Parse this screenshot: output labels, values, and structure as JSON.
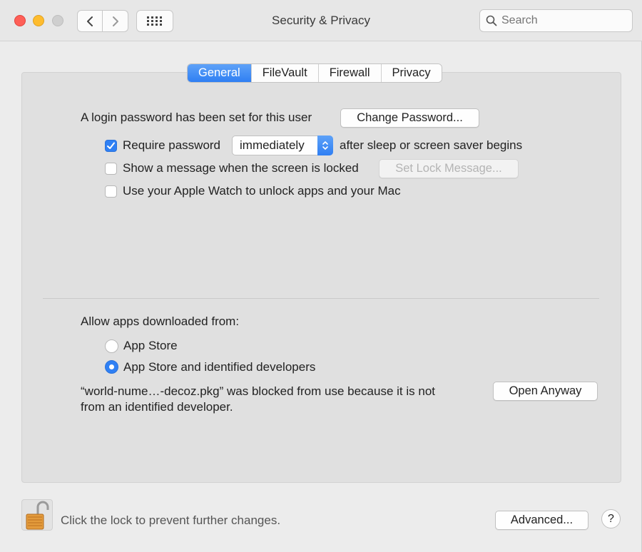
{
  "window": {
    "title": "Security & Privacy"
  },
  "toolbar": {
    "back_icon": "chevron-left-icon",
    "forward_icon": "chevron-right-icon",
    "show_all_icon": "grid-icon",
    "search_placeholder": "Search"
  },
  "tabs": [
    {
      "label": "General",
      "active": true
    },
    {
      "label": "FileVault",
      "active": false
    },
    {
      "label": "Firewall",
      "active": false
    },
    {
      "label": "Privacy",
      "active": false
    }
  ],
  "general": {
    "login_password_text": "A login password has been set for this user",
    "change_password_button": "Change Password...",
    "require_password": {
      "label": "Require password",
      "checked": true,
      "popup_value": "immediately",
      "suffix": "after sleep or screen saver begins"
    },
    "show_message": {
      "label": "Show a message when the screen is locked",
      "checked": false,
      "button": "Set Lock Message..."
    },
    "apple_watch": {
      "label": "Use your Apple Watch to unlock apps and your Mac",
      "checked": false
    },
    "allow_apps_heading": "Allow apps downloaded from:",
    "radio_options": [
      {
        "label": "App Store",
        "selected": false
      },
      {
        "label": "App Store and identified developers",
        "selected": true
      }
    ],
    "blocked_line1": "“world-nume…-decoz.pkg” was blocked from use because it is not",
    "blocked_line2": "from an identified developer.",
    "open_anyway_button": "Open Anyway"
  },
  "footer": {
    "lock_text": "Click the lock to prevent further changes.",
    "advanced_button": "Advanced...",
    "help_button": "?"
  },
  "colors": {
    "accent": "#2f80f4",
    "close": "#fe5f57",
    "minimize": "#febc2e",
    "zoom": "#cfcfcf"
  }
}
